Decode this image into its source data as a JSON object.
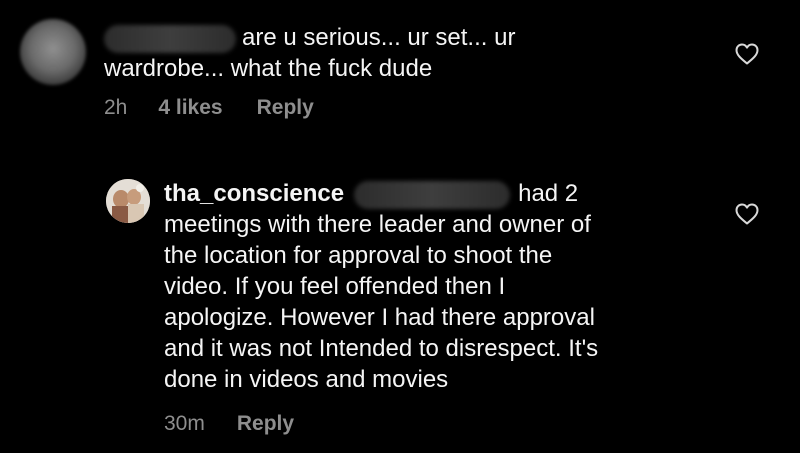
{
  "comment1": {
    "text_line1": "are u serious... ur set... ur",
    "text_line2": "wardrobe... what the fuck dude",
    "time": "2h",
    "likes": "4 likes",
    "reply_label": "Reply"
  },
  "comment2": {
    "username": "tha_conscience",
    "line1_tail": "had 2",
    "lines": [
      "meetings with there leader and owner of",
      "the location for approval to shoot the",
      "video. If you feel offended then I",
      "apologize. However I had there approval",
      "and it was not Intended to disrespect. It's",
      "done in videos and movies"
    ],
    "time": "30m",
    "reply_label": "Reply"
  },
  "icons": {
    "like": "heart-outline-icon"
  },
  "colors": {
    "background": "#000000",
    "text": "#f5f5f5",
    "meta": "#8e8e8e"
  }
}
